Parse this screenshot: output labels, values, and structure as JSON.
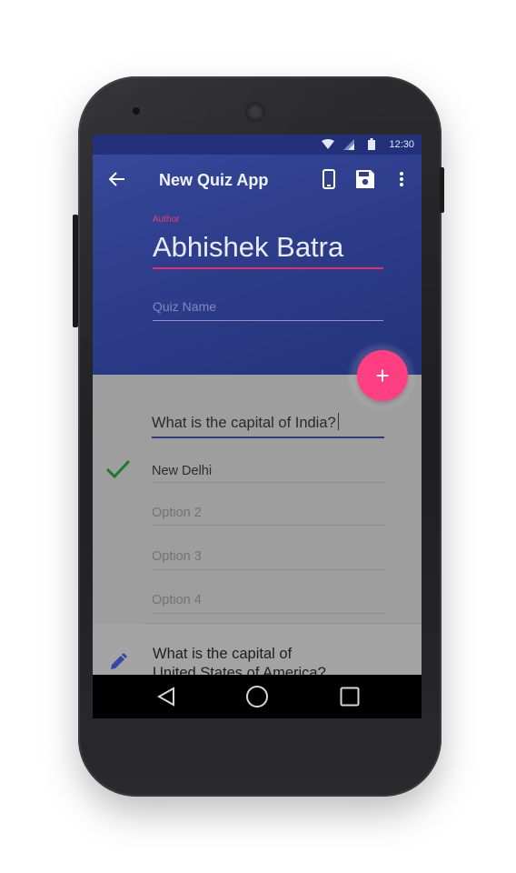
{
  "status_bar": {
    "time": "12:30"
  },
  "app_bar": {
    "back_icon": "arrow-left-icon",
    "title": "New Quiz App",
    "actions": [
      "phone-preview-icon",
      "save-icon",
      "more-vert-icon"
    ]
  },
  "form": {
    "author_label": "Author",
    "author_value": "Abhishek Batra",
    "quiz_name_placeholder": "Quiz Name"
  },
  "fab": {
    "label": "+"
  },
  "question1": {
    "text": "What is the capital of India?",
    "options": [
      "New Delhi",
      "Option 2",
      "Option 3",
      "Option 4"
    ],
    "correct_index": 0
  },
  "question2": {
    "text_line1": "What is the capital of",
    "text_line2": "United States of America?"
  },
  "colors": {
    "primary": "#2a3a86",
    "accent": "#ff3f81",
    "check": "#1b7a2a",
    "pencil": "#3446a8"
  }
}
